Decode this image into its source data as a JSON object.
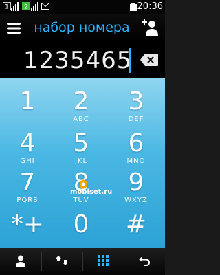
{
  "status_bar": {
    "sim1_label": "1",
    "sim2_label": "2",
    "time": "20:36"
  },
  "header": {
    "title": "набор номера"
  },
  "display": {
    "number": "1235465"
  },
  "keypad": {
    "keys": [
      {
        "digit": "1",
        "letters": ""
      },
      {
        "digit": "2",
        "letters": "ABC"
      },
      {
        "digit": "3",
        "letters": "DEF"
      },
      {
        "digit": "4",
        "letters": "GHI"
      },
      {
        "digit": "5",
        "letters": "JKL"
      },
      {
        "digit": "6",
        "letters": "MNO"
      },
      {
        "digit": "7",
        "letters": "PQRS"
      },
      {
        "digit": "8",
        "letters": "TUV"
      },
      {
        "digit": "9",
        "letters": "WXYZ"
      },
      {
        "digit": "*+",
        "letters": ""
      },
      {
        "digit": "0",
        "letters": ""
      },
      {
        "digit": "#",
        "letters": ""
      }
    ]
  },
  "watermark": {
    "text": "mobiset.ru"
  },
  "bottom_bar": {
    "buttons": [
      "contacts-icon",
      "call-log-icon",
      "dialpad-icon",
      "back-icon"
    ]
  },
  "colors": {
    "accent": "#2db3ff",
    "keypad_top": "#8fd5f0",
    "keypad_bottom": "#2ca2d6"
  }
}
